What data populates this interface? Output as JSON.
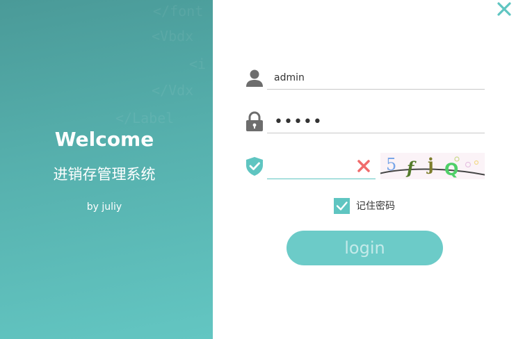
{
  "colors": {
    "accent": "#5fc5c1",
    "panel_top": "#4a9a98",
    "panel_bottom": "#63c6c2",
    "clear_red": "#f06c6c"
  },
  "left_panel": {
    "welcome": "Welcome",
    "system_name": "进销存管理系统",
    "author": "by juliy"
  },
  "form": {
    "username_value": "admin",
    "password_value": "•••••",
    "captcha_input_value": "",
    "captcha_text": "5fjQ",
    "remember_label": "记住密码",
    "remember_checked": true,
    "login_label": "login"
  },
  "icons": [
    "close-icon",
    "user-icon",
    "lock-icon",
    "shield-check-icon",
    "clear-x-icon",
    "checkmark-icon"
  ]
}
